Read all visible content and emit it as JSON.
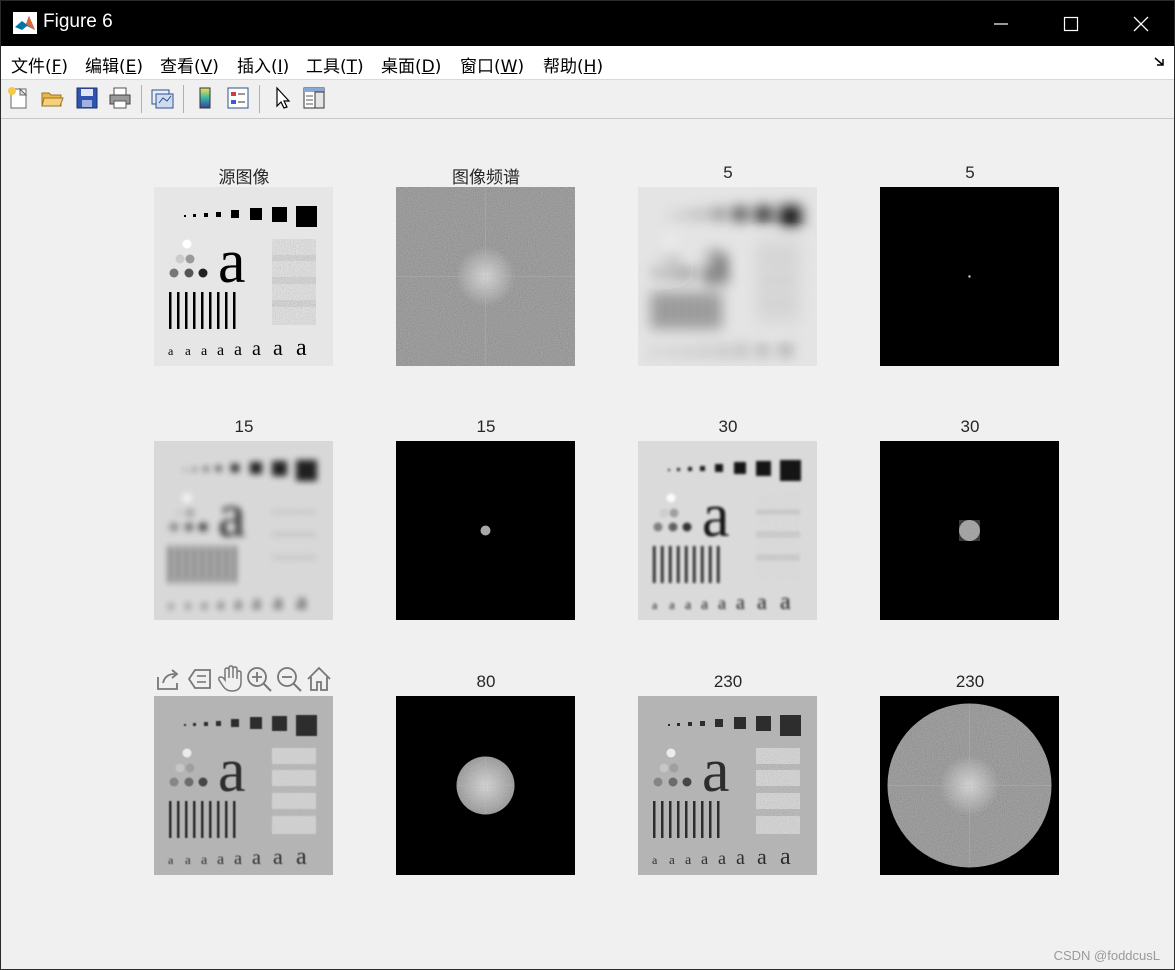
{
  "window": {
    "title": "Figure 6",
    "icon": "matlab-icon",
    "controls": [
      "minimize-icon",
      "maximize-icon",
      "close-icon"
    ]
  },
  "menubar": {
    "items": [
      {
        "label": "文件(",
        "key": "F",
        "suffix": ")"
      },
      {
        "label": "编辑(",
        "key": "E",
        "suffix": ")"
      },
      {
        "label": "查看(",
        "key": "V",
        "suffix": ")"
      },
      {
        "label": "插入(",
        "key": "I",
        "suffix": ")"
      },
      {
        "label": "工具(",
        "key": "T",
        "suffix": ")"
      },
      {
        "label": "桌面(",
        "key": "D",
        "suffix": ")"
      },
      {
        "label": "窗口(",
        "key": "W",
        "suffix": ")"
      },
      {
        "label": "帮助(",
        "key": "H",
        "suffix": ")"
      }
    ],
    "overflow_icon": "dock-arrow-icon"
  },
  "toolbar": {
    "buttons": [
      "new-figure-icon",
      "open-file-icon",
      "save-icon",
      "print-icon",
      "link-plot-icon",
      "colorbar-icon",
      "legend-icon",
      "pointer-icon",
      "property-inspector-icon"
    ]
  },
  "figure": {
    "panels": [
      {
        "title": "源图像",
        "kind": "source"
      },
      {
        "title": "图像频谱",
        "kind": "spectrum"
      },
      {
        "title": "5",
        "kind": "blur"
      },
      {
        "title": "5",
        "kind": "mask"
      },
      {
        "title": "15",
        "kind": "blur"
      },
      {
        "title": "15",
        "kind": "mask"
      },
      {
        "title": "30",
        "kind": "blur"
      },
      {
        "title": "30",
        "kind": "mask"
      },
      {
        "title": "",
        "kind": "sharp"
      },
      {
        "title": "80",
        "kind": "mask"
      },
      {
        "title": "230",
        "kind": "sharp"
      },
      {
        "title": "230",
        "kind": "mask"
      }
    ],
    "axes_toolbar": [
      "export-icon",
      "data-tips-icon",
      "pan-hand-icon",
      "zoom-in-icon",
      "zoom-out-icon",
      "home-icon"
    ]
  },
  "watermark": "CSDN @foddcusL"
}
